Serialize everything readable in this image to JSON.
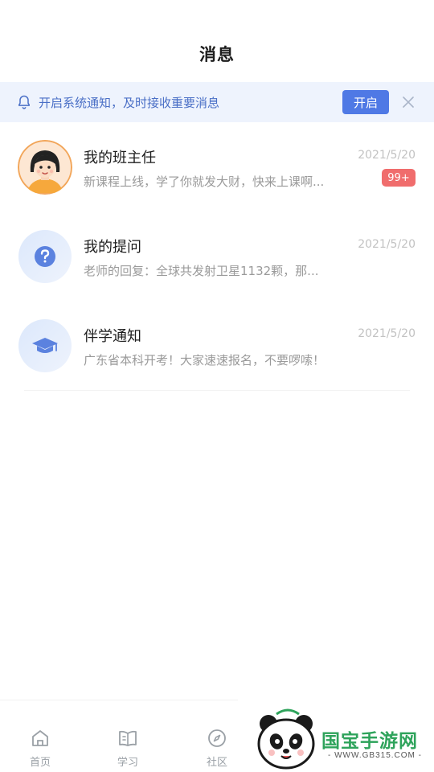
{
  "header": {
    "title": "消息"
  },
  "notice": {
    "text": "开启系统通知，及时接收重要消息",
    "button_label": "开启"
  },
  "messages": [
    {
      "title": "我的班主任",
      "time": "2021/5/20",
      "preview": "新课程上线，学了你就发大财，快来上课啊...",
      "badge": "99+",
      "avatar": "teacher-avatar"
    },
    {
      "title": "我的提问",
      "time": "2021/5/20",
      "preview": "老师的回复：全球共发射卫星1132颗，那...",
      "avatar": "question-icon"
    },
    {
      "title": "伴学通知",
      "time": "2021/5/20",
      "preview": "广东省本科开考！大家速速报名，不要啰嗦！",
      "avatar": "graduation-cap-icon"
    }
  ],
  "tabbar": {
    "tabs": [
      {
        "label": "首页",
        "icon": "home-icon"
      },
      {
        "label": "学习",
        "icon": "book-icon"
      },
      {
        "label": "社区",
        "icon": "compass-icon"
      }
    ]
  },
  "watermark": {
    "brand": "国宝手游网",
    "url": "- WWW.GB315.COM -"
  },
  "colors": {
    "accent": "#4f79e5",
    "badge": "#f06d6d",
    "notice_bg": "#eef3fd"
  }
}
